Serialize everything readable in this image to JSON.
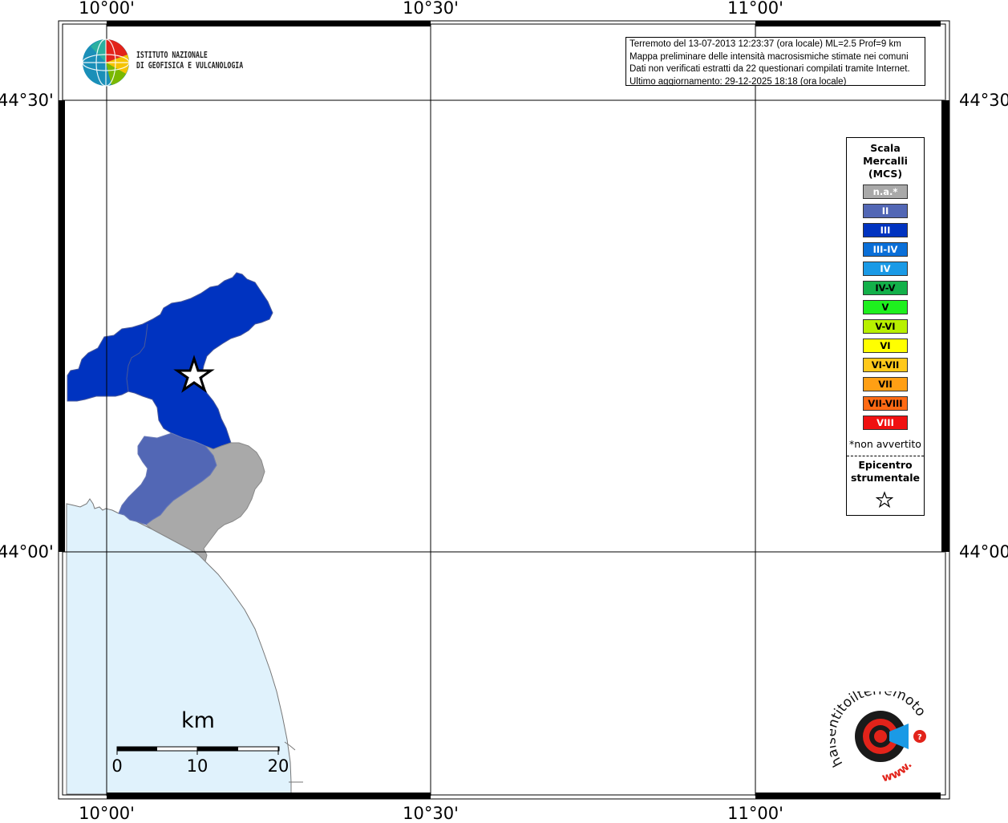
{
  "axes": {
    "top_lon_labels": [
      "10°00'",
      "10°30'",
      "11°00'"
    ],
    "bottom_lon_labels": [
      "10°00'",
      "10°30'",
      "11°00'"
    ],
    "left_lat_labels": [
      "44°30'",
      "44°00'"
    ],
    "right_lat_labels": [
      "44°30'",
      "44°00'"
    ]
  },
  "info": {
    "line1": "Terremoto del 13-07-2013 12:23:37 (ora locale) ML=2.5 Prof=9 km",
    "line2": "Mappa preliminare delle intensità macrosismiche stimate nei comuni",
    "line3": "Dati non verificati estratti da 22 questionari compilati tramite Internet.",
    "line4": "Ultimo aggiornamento: 29-12-2025 18:18 (ora locale)"
  },
  "institute": {
    "line1": "ISTITUTO NAZIONALE",
    "line2": "DI GEOFISICA E VULCANOLOGIA"
  },
  "legend": {
    "title_lines": [
      "Scala",
      "Mercalli",
      "(MCS)"
    ],
    "items": [
      {
        "label": "n.a.*",
        "color": "#a9a9a9",
        "text_color": "#ffffff"
      },
      {
        "label": "II",
        "color": "#5267b5",
        "text_color": "#ffffff"
      },
      {
        "label": "III",
        "color": "#0033c0",
        "text_color": "#ffffff"
      },
      {
        "label": "III-IV",
        "color": "#0a6fd8",
        "text_color": "#ffffff"
      },
      {
        "label": "IV",
        "color": "#1a9ae6",
        "text_color": "#ffffff"
      },
      {
        "label": "IV-V",
        "color": "#13b04a",
        "text_color": "#000000"
      },
      {
        "label": "V",
        "color": "#1ef01e",
        "text_color": "#000000"
      },
      {
        "label": "V-VI",
        "color": "#b8f000",
        "text_color": "#000000"
      },
      {
        "label": "VI",
        "color": "#ffff00",
        "text_color": "#000000"
      },
      {
        "label": "VI-VII",
        "color": "#ffc81a",
        "text_color": "#000000"
      },
      {
        "label": "VII",
        "color": "#ff9f14",
        "text_color": "#000000"
      },
      {
        "label": "VII-VIII",
        "color": "#ff6a14",
        "text_color": "#000000"
      },
      {
        "label": "VIII",
        "color": "#f01010",
        "text_color": "#ffffff"
      }
    ],
    "note": "*non avvertito",
    "epicenter_lines": [
      "Epicentro",
      "strumentale"
    ]
  },
  "scale_bar": {
    "unit": "km",
    "ticks": [
      "0",
      "10",
      "20"
    ]
  },
  "logo_haisentito": {
    "text": "haisentitoilterremoto.it",
    "prefix": "www."
  },
  "map_regions": [
    {
      "name": "comune-north",
      "intensity": "III",
      "color": "#0033c0"
    },
    {
      "name": "comune-middle",
      "intensity": "II",
      "color": "#5267b5"
    },
    {
      "name": "comune-south",
      "intensity": "n.a.*",
      "color": "#a9a9a9"
    }
  ],
  "sea_color": "#e0f2fc"
}
